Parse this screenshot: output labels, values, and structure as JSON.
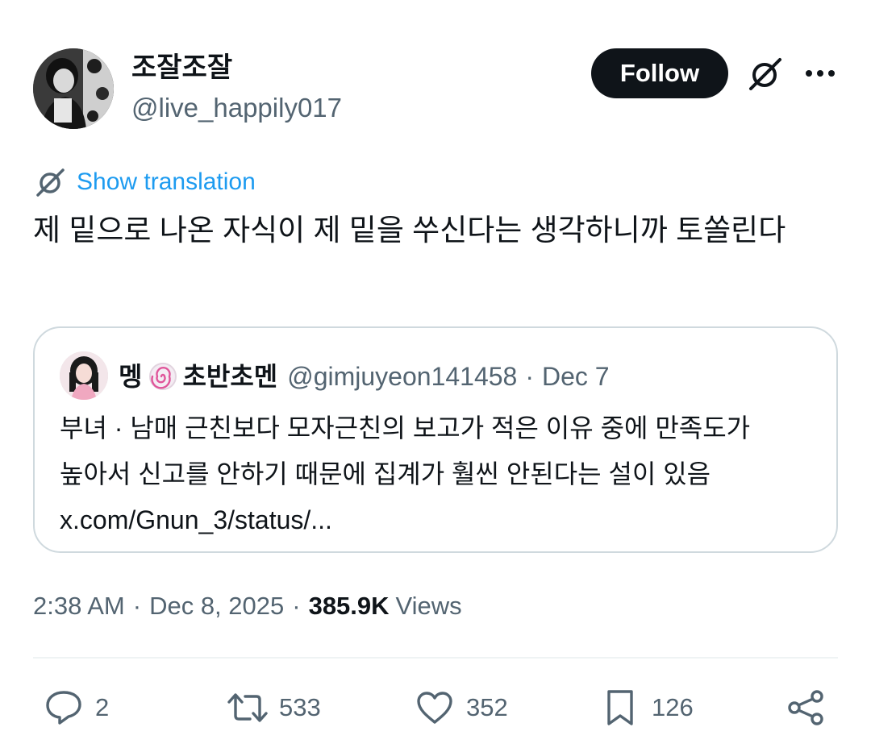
{
  "author": {
    "display_name": "조잘조잘",
    "handle": "@live_happily017",
    "avatar_icon": "avatar-photo"
  },
  "header": {
    "follow_label": "Follow",
    "grok_icon": "grok-icon",
    "more_icon": "more-icon"
  },
  "translation": {
    "label": "Show translation",
    "icon": "grok-icon"
  },
  "tweet": {
    "text": "제 밑으로 나온 자식이 제 밑을 쑤신다는 생각하니까 토쏠린다"
  },
  "quote": {
    "name_part1": "멩",
    "emoji": "🍥",
    "name_part2": "초반초멘",
    "handle": "@gimjuyeon141458",
    "separator": "·",
    "date": "Dec 7",
    "text": "부녀 · 남매 근친보다 모자근친의 보고가 적은 이유 중에 만족도가 높아서 신고를 안하기 때문에 집계가 훨씬 안된다는 설이 있음 x.com/Gnun_3/status/..."
  },
  "meta": {
    "time": "2:38 AM",
    "separator": "·",
    "date": "Dec 8, 2025",
    "views_count": "385.9K",
    "views_label": "Views"
  },
  "actions": {
    "replies": "2",
    "reposts": "533",
    "likes": "352",
    "bookmarks": "126"
  },
  "colors": {
    "text": "#0f1419",
    "secondary": "#536471",
    "link": "#1d9bf0",
    "border": "#cfd9de",
    "divider": "#eff3f4"
  }
}
